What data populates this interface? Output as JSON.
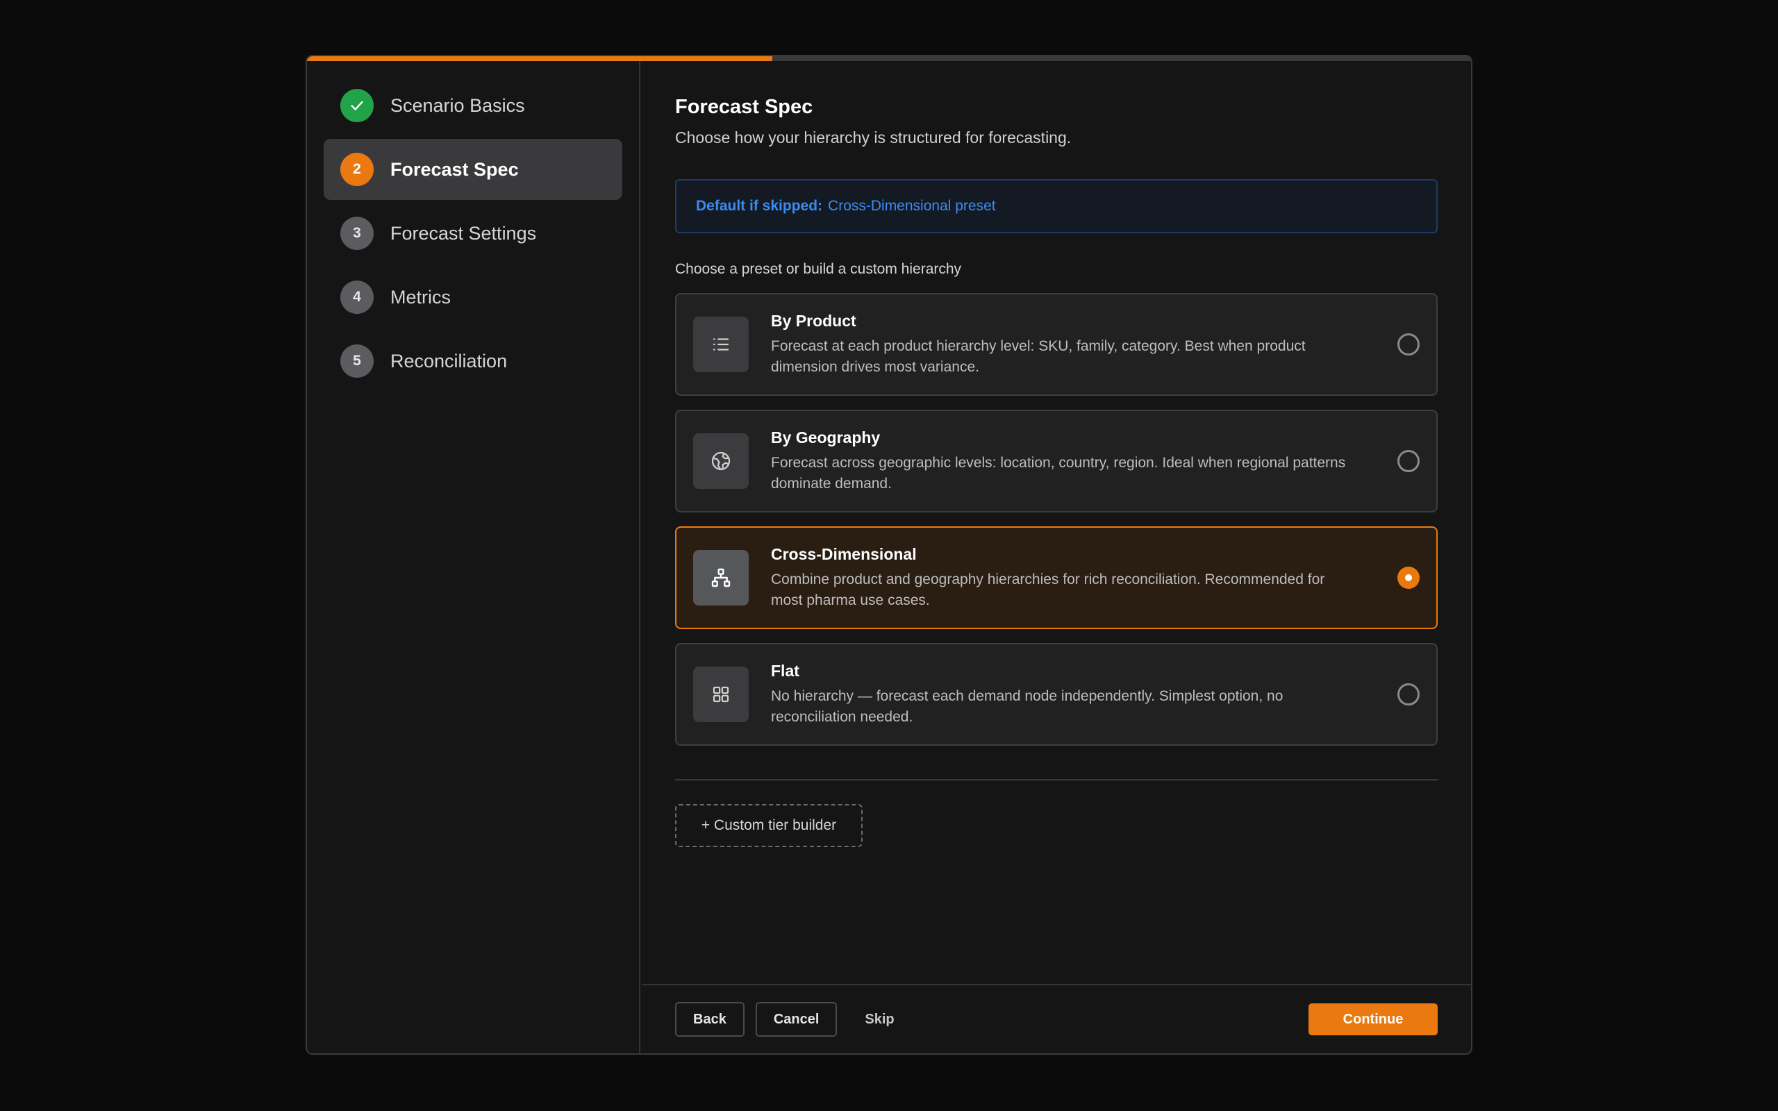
{
  "progress": {
    "fraction": 0.4
  },
  "colors": {
    "accent": "#ea7a10",
    "success": "#22a34a",
    "info": "#3d8bf0"
  },
  "steps": [
    {
      "number": "",
      "label": "Scenario Basics",
      "state": "done",
      "icon": "check-icon"
    },
    {
      "number": "2",
      "label": "Forecast Spec",
      "state": "current"
    },
    {
      "number": "3",
      "label": "Forecast Settings",
      "state": "pending"
    },
    {
      "number": "4",
      "label": "Metrics",
      "state": "pending"
    },
    {
      "number": "5",
      "label": "Reconciliation",
      "state": "pending"
    }
  ],
  "main": {
    "title": "Forecast Spec",
    "subtitle": "Choose how your hierarchy is structured for forecasting.",
    "notice": {
      "label": "Default if skipped:",
      "value": "Cross-Dimensional preset"
    },
    "section_label": "Choose a preset or build a custom hierarchy",
    "options": [
      {
        "title": "By Product",
        "description": "Forecast at each product hierarchy level: SKU, family, category. Best when product dimension drives most variance.",
        "icon": "list-icon",
        "selected": false
      },
      {
        "title": "By Geography",
        "description": "Forecast across geographic levels: location, country, region. Ideal when regional patterns dominate demand.",
        "icon": "globe-icon",
        "selected": false
      },
      {
        "title": "Cross-Dimensional",
        "description": "Combine product and geography hierarchies for rich reconciliation. Recommended for most pharma use cases.",
        "icon": "hierarchy-icon",
        "selected": true
      },
      {
        "title": "Flat",
        "description": "No hierarchy — forecast each demand node independently. Simplest option, no reconciliation needed.",
        "icon": "grid-icon",
        "selected": false
      }
    ],
    "custom_builder_label": "+ Custom tier builder"
  },
  "footer": {
    "back_label": "Back",
    "cancel_label": "Cancel",
    "skip_label": "Skip",
    "continue_label": "Continue"
  }
}
